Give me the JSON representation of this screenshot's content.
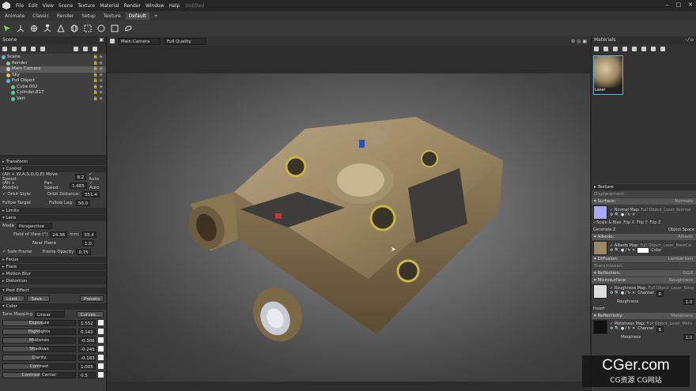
{
  "app": {
    "title": "Untitled",
    "menu": [
      "File",
      "Edit",
      "View",
      "Scene",
      "Texture",
      "Material",
      "Render",
      "Window",
      "Help"
    ]
  },
  "tabs": [
    "Animate",
    "Classic",
    "Render",
    "Setup",
    "Texture",
    "Default",
    "+"
  ],
  "scene_panel": {
    "title": "Scene",
    "tree": [
      {
        "label": "Scene",
        "depth": 0,
        "sel": false
      },
      {
        "label": "Render",
        "depth": 1,
        "sel": false
      },
      {
        "label": "Main Camera",
        "depth": 1,
        "sel": true
      },
      {
        "label": "Sky",
        "depth": 1,
        "sel": false
      },
      {
        "label": "Full Object",
        "depth": 1,
        "sel": false
      },
      {
        "label": "Cube.002",
        "depth": 2,
        "sel": false
      },
      {
        "label": "Cylinder.817",
        "depth": 2,
        "sel": false
      },
      {
        "label": "Vert",
        "depth": 2,
        "sel": false
      }
    ],
    "sections": {
      "transform": "Transform",
      "control": "Control",
      "limits": "Limits",
      "lens": "Lens",
      "focus": "Focus",
      "flare": "Flare",
      "motion_blur": "Motion Blur",
      "distortion": "Distortion",
      "post_effect": "Post Effect",
      "color": "Color"
    },
    "control": {
      "move_label": "(Alt + W,A,S,D,Q,E) Move Speed:",
      "move_val": "8.2",
      "auto1": "✓ Auto",
      "pan_label": "(Alt + Middle)",
      "pan_speed_label": "Pan Speed:",
      "pan_val": "1.685",
      "auto2": "✓ Auto",
      "orbit_label": "✓ Orbit Style",
      "orbit_dist_label": "Orbit Distance:",
      "orbit_dist_val": "551.4",
      "follow_label": "Follow Target",
      "follow_lag_label": "Follow Lag:",
      "follow_lag_val": "50.0"
    },
    "lens": {
      "mode_label": "Mode",
      "mode_val": "Perspective",
      "fov_label": "Field of View (°)",
      "fov_val": "24.36",
      "mm_label": "mm:",
      "mm_val": "55.4",
      "near_label": "Near Plane",
      "near_val": "1.0",
      "safe_label": "✓ Safe Frame",
      "frame_op_label": "Frame Opacity",
      "frame_op_val": "0.75"
    },
    "post": {
      "load": "Load...",
      "save": "Save...",
      "presets": "Presets"
    },
    "color": {
      "tonemap_label": "Tone Mapping",
      "tonemap_val": "Linear",
      "curves": "Curves...",
      "rows": [
        {
          "label": "Exposure",
          "value": "1.552",
          "fill": 0.55
        },
        {
          "label": "Highlights",
          "value": "0.142",
          "fill": 0.5
        },
        {
          "label": "Midtones",
          "value": "-0.306",
          "fill": 0.42
        },
        {
          "label": "Shadows",
          "value": "-0.245",
          "fill": 0.44
        },
        {
          "label": "Clarity",
          "value": "-0.183",
          "fill": 0.45
        },
        {
          "label": "Contrast",
          "value": "1.005",
          "fill": 0.5
        },
        {
          "label": "Contrast Center",
          "value": "0.5",
          "fill": 0.5
        }
      ]
    }
  },
  "viewport": {
    "camera": "Main Camera",
    "quality": "Full Quality"
  },
  "materials_panel": {
    "title": "Materials",
    "thumb_label": "Laser",
    "texture": "Texture",
    "displacement": "Displacement",
    "surface": {
      "title": "Surface:",
      "value": "Normals",
      "map_label": "✓ Normal Map:",
      "map_val": "Full Object_Laser_Normal",
      "scale": "✓Scale & Bias",
      "flipx": "Flip X",
      "flipy": "Flip Y",
      "flipz": "Flip Z",
      "gen_z": "Generate Z",
      "obj_space": "Object Space"
    },
    "albedo": {
      "title": "Albedo:",
      "value": "Albedo",
      "map_label": "✓ Albedo Map:",
      "map_val": "Full Object_Laser_BaseCol",
      "color": "Color"
    },
    "diffusion": {
      "title": "Diffusion:",
      "value": "Lambertian"
    },
    "transmission": "Transmission:",
    "reflection": {
      "title": "Reflection:",
      "value": "GGX"
    },
    "microsurface": {
      "title": "Microsurface:",
      "value": "Roughness",
      "map_label": "✓ Roughness Map:",
      "map_val": "Full Object_Laser_Roug",
      "channel": "Channel",
      "ch_val": "R",
      "rough_label": "Roughness",
      "rough_val": "1.0",
      "invert": "Invert"
    },
    "reflectivity": {
      "title": "Reflectivity:",
      "value": "Metalness",
      "map_label": "✓ Metalness Map:",
      "map_val": "Full Object_Laser_Meta",
      "channel": "Channel",
      "ch_val": "B",
      "metal_label": "Metalness",
      "metal_val": "1.0"
    }
  },
  "watermark": {
    "line1": "CGer.com",
    "line2": "CG资源 CG网站"
  },
  "colors": {
    "accent": "#6ab0d8",
    "bg": "#2a2a2a"
  }
}
